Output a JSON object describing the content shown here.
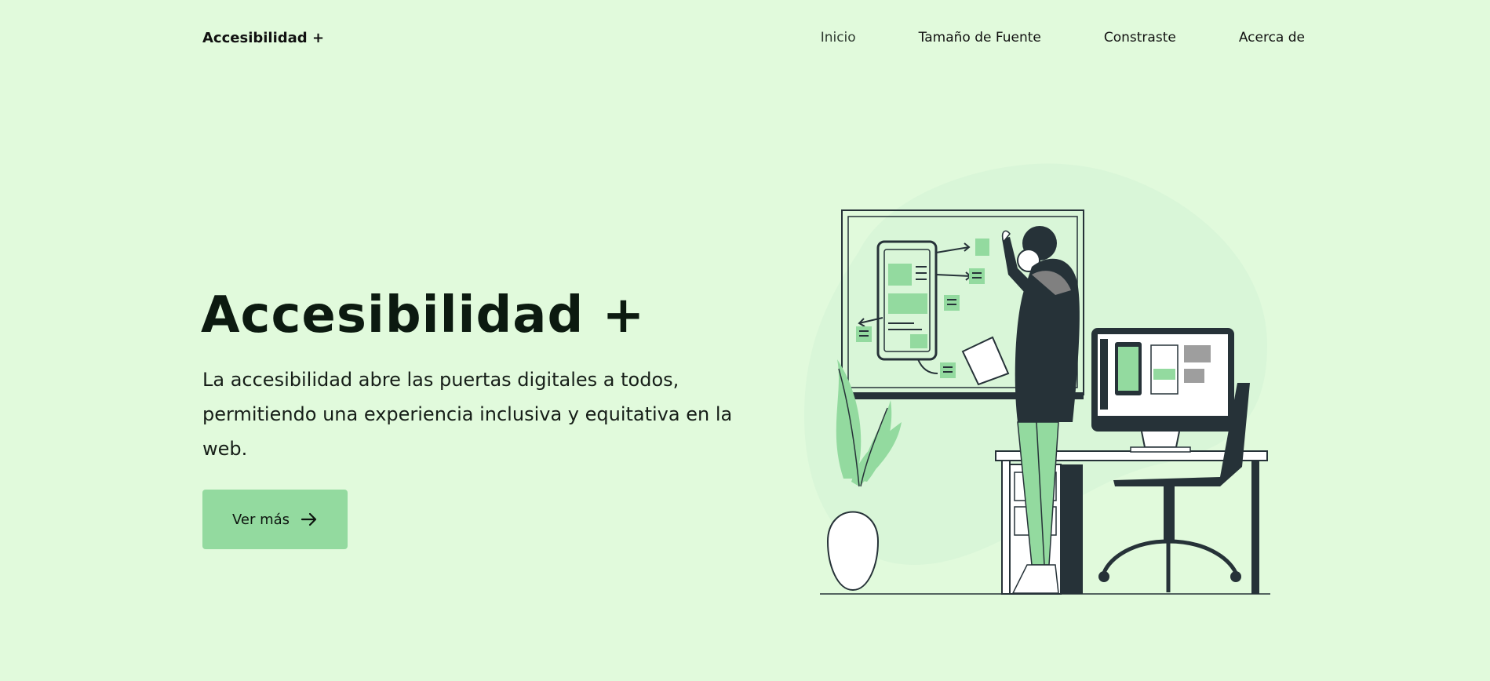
{
  "header": {
    "brand": "Accesibilidad +",
    "nav": [
      "Inicio",
      "Tamaño de Fuente",
      "Constraste",
      "Acerca de"
    ]
  },
  "hero": {
    "title": "Accesibilidad +",
    "description": "La accesibilidad abre las puertas digitales a todos, permitiendo una experiencia inclusiva y equitativa en la web.",
    "cta_label": "Ver más"
  },
  "colors": {
    "background": "#e1fadc",
    "accent": "#93da9f",
    "dark": "#263238"
  },
  "icons": {
    "cta_icon": "arrow-right-icon",
    "illustration": "person-at-whiteboard-illustration"
  }
}
